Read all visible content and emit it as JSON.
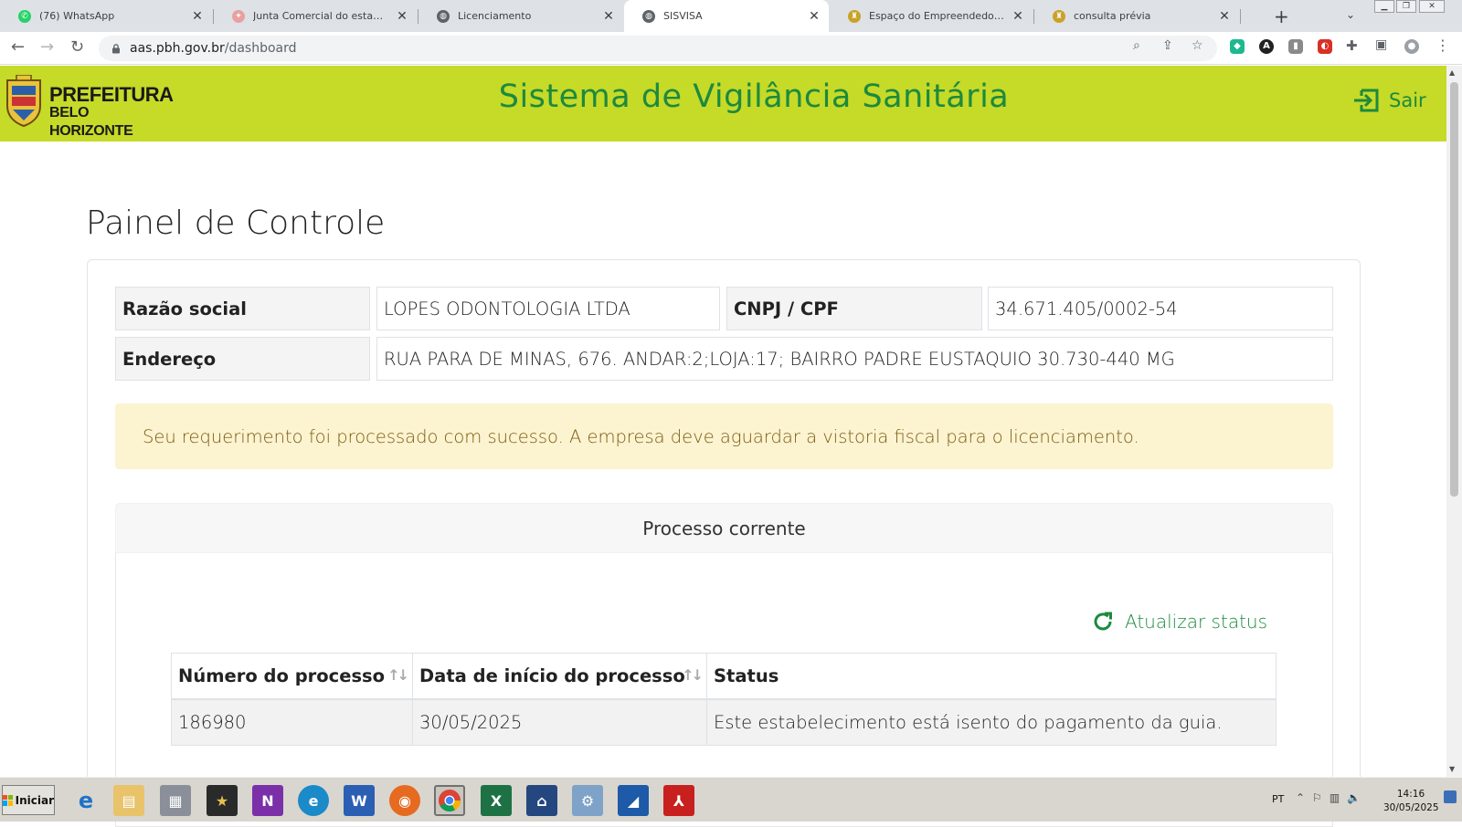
{
  "browser": {
    "tabs": [
      {
        "title": "(76) WhatsApp",
        "color": "#25d366",
        "glyph": "✆"
      },
      {
        "title": "Junta Comercial do estado de Minas",
        "color": "#e8a0a0",
        "glyph": "✦"
      },
      {
        "title": "Licenciamento",
        "color": "#5f6368",
        "glyph": "◍"
      },
      {
        "title": "SISVISA",
        "color": "#5f6368",
        "glyph": "◍",
        "active": true
      },
      {
        "title": "Espaço do Empreendedor - Alvará",
        "color": "#c9a227",
        "glyph": "♜"
      },
      {
        "title": "consulta prévia",
        "color": "#c9a227",
        "glyph": "♜"
      }
    ],
    "new_tab": "+",
    "tab_menu": "⌄",
    "url_host": "aas.pbh.gov.br",
    "url_path": "/dashboard"
  },
  "header": {
    "logo_line1": "PREFEITURA",
    "logo_line2": "BELO HORIZONTE",
    "title": "Sistema de Vigilância Sanitária",
    "logout_label": "Sair"
  },
  "page": {
    "title": "Painel de Controle"
  },
  "company": {
    "razao_label": "Razão social",
    "razao_value": "LOPES ODONTOLOGIA LTDA",
    "cnpj_label": "CNPJ / CPF",
    "cnpj_value": "34.671.405/0002-54",
    "endereco_label": "Endereço",
    "endereco_value": "RUA PARA DE MINAS, 676. ANDAR:2;LOJA:17; BAIRRO PADRE EUSTAQUIO 30.730-440 MG"
  },
  "alert": {
    "message": "Seu requerimento foi processado com sucesso. A empresa deve aguardar a vistoria fiscal para o licenciamento."
  },
  "process": {
    "section_title": "Processo corrente",
    "refresh_label": "Atualizar status",
    "columns": [
      "Número do processo",
      "Data de início do processo",
      "Status"
    ],
    "rows": [
      [
        "186980",
        "30/05/2025",
        "Este estabelecimento está isento do pagamento da guia."
      ]
    ]
  },
  "taskbar": {
    "start_label": "Iniciar",
    "language": "PT",
    "time": "14:16",
    "date": "30/05/2025"
  },
  "colors": {
    "header_bg": "#c6da28",
    "brand_green": "#1c8a3e",
    "alert_bg": "#fcf3d1",
    "alert_text": "#7a5c10"
  }
}
